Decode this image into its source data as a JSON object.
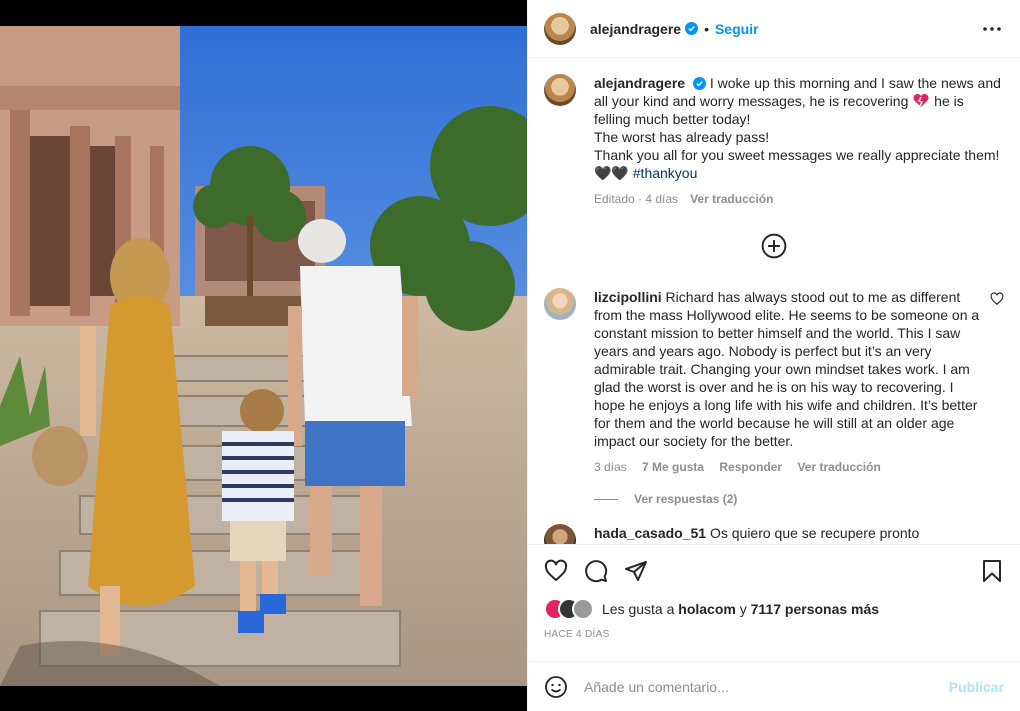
{
  "post": {
    "author": "alejandragere",
    "follow_label": "Seguir",
    "dot": "•"
  },
  "caption": {
    "username": "alejandragere",
    "line1": " I woke up this morning and I saw the news and all your kind and worry messages, he is recovering ",
    "line1_end": " he is felling much better today!",
    "line2": "The worst has already pass!",
    "line3": "Thank you all for you sweet messages we really appreciate them! 🖤🖤 ",
    "hashtag": "#thankyou",
    "meta_edited": "Editado · 4 días",
    "meta_translate": "Ver traducción"
  },
  "comments": [
    {
      "username": "lizcipollini",
      "text": " Richard has always stood out to me as different from the mass Hollywood elite. He seems to be someone on a constant mission to better himself and the world. This I saw years and years ago. Nobody is perfect but it’s an very admirable trait. Changing your own mindset takes work. I am glad the worst is over and he is on his way to recovering. I hope he enjoys a long life with his wife and children. It’s better for them and the world because he will still at an older age impact our society for the better.",
      "age": "3 días",
      "likes": "7 Me gusta",
      "reply": "Responder",
      "translate": "Ver traducción",
      "view_replies": "Ver respuestas (2)"
    },
    {
      "username": "hada_casado_51",
      "text": " Os quiero que se recupere pronto"
    }
  ],
  "likes": {
    "prefix": "Les gusta a ",
    "user": "holacom",
    "middle": " y ",
    "count": "7117 personas más"
  },
  "timestamp": "Hace 4 días",
  "comment_box": {
    "placeholder": "Añade un comentario...",
    "publish": "Publicar"
  },
  "colors": {
    "accent": "#0095f6",
    "publish_disabled": "#b2dffc",
    "secondary_text": "#8e8e8e"
  },
  "icons": [
    "verified-icon",
    "more-options-icon",
    "add-circle-icon",
    "heart-icon",
    "comment-icon",
    "share-icon",
    "bookmark-icon",
    "emoji-icon"
  ]
}
